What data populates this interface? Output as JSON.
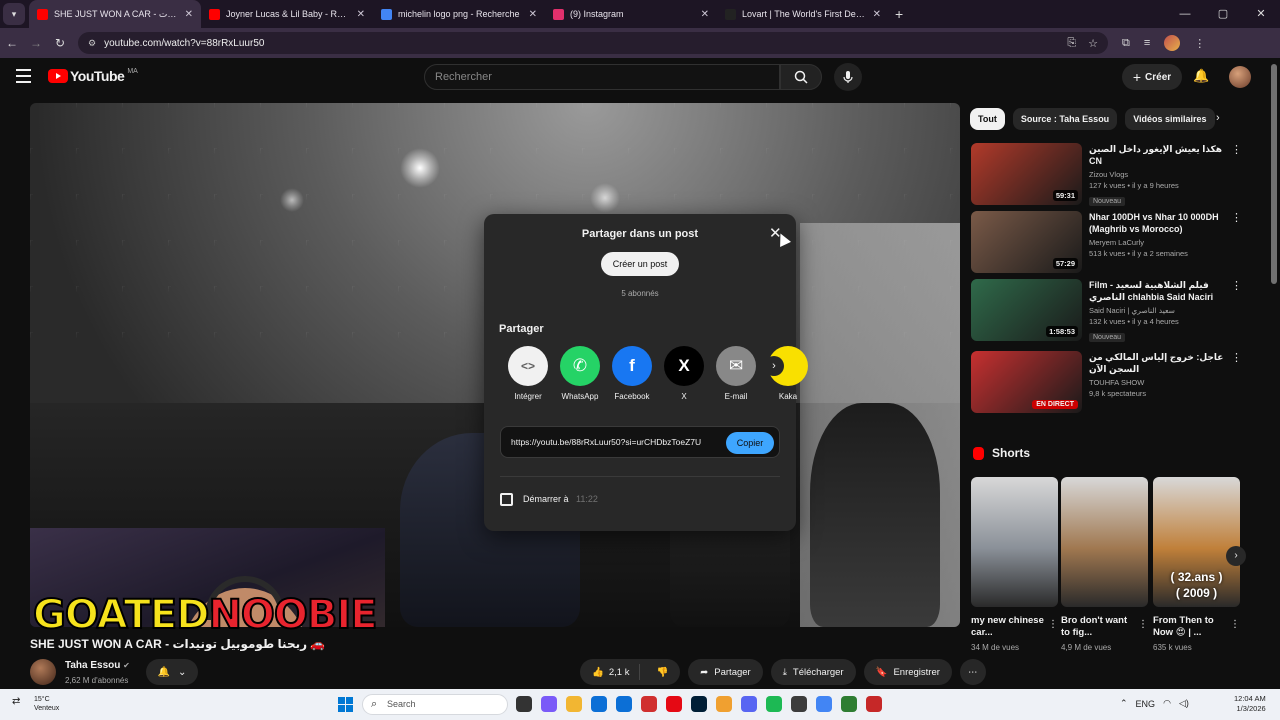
{
  "browser": {
    "tabs": [
      {
        "title": "SHE JUST WON A CAR - ربحنا طوموبيل تونيدات",
        "favicon_color": "#ff0000",
        "active": true
      },
      {
        "title": "Joyner Lucas & Lil Baby - Ramen",
        "favicon_color": "#ff0000",
        "active": false
      },
      {
        "title": "michelin logo png - Recherche",
        "favicon_color": "#4285f4",
        "active": false
      },
      {
        "title": "(9) Instagram",
        "favicon_color": "#e1306c",
        "active": false
      },
      {
        "title": "Lovart | The World's First Design",
        "favicon_color": "#222222",
        "active": false
      }
    ],
    "url": "youtube.com/watch?v=88rRxLuur50"
  },
  "youtube": {
    "logo_text": "YouTube",
    "country": "MA",
    "search_placeholder": "Rechercher",
    "create_label": "Créer"
  },
  "share_dialog": {
    "title": "Partager dans un post",
    "create_post": "Créer un post",
    "subscribers": "5 abonnés",
    "share_heading": "Partager",
    "targets": [
      {
        "label": "Intégrer",
        "glyph": "<>",
        "bg": "#f1f1f1",
        "fg": "#606060"
      },
      {
        "label": "WhatsApp",
        "glyph": "✆",
        "bg": "#25d366",
        "fg": "#ffffff"
      },
      {
        "label": "Facebook",
        "glyph": "f",
        "bg": "#1877f2",
        "fg": "#ffffff"
      },
      {
        "label": "X",
        "glyph": "X",
        "bg": "#000000",
        "fg": "#ffffff"
      },
      {
        "label": "E-mail",
        "glyph": "✉",
        "bg": "#888888",
        "fg": "#ffffff"
      },
      {
        "label": "Kaka",
        "glyph": "",
        "bg": "#f9e000",
        "fg": "#000000"
      }
    ],
    "link": "https://youtu.be/88rRxLuur50?si=urCHDbzToeZ7U",
    "copy_label": "Copier",
    "start_at_label": "Démarrer à",
    "start_time": "11:22"
  },
  "video": {
    "overlay_left": "GOATED",
    "overlay_right": "NOOBIE",
    "title": "SHE JUST WON A CAR - ربحنا طوموبيل تونيدات 🚗",
    "channel": "Taha Essou",
    "channel_subs": "2,62 M d'abonnés",
    "likes": "2,1 k",
    "share_label": "Partager",
    "download_label": "Télécharger",
    "save_label": "Enregistrer"
  },
  "sidebar": {
    "chips": [
      "Tout",
      "Source : Taha Essou",
      "Vidéos similaires"
    ],
    "recommendations": [
      {
        "title": "هكذا يعيش الإيغور داخل الصين CN",
        "channel": "Zizou Vlogs",
        "meta": "127 k vues • il y a 9 heures",
        "badge": "Nouveau",
        "duration": "59:31",
        "thumb": "#b23a2a"
      },
      {
        "title": "Nhar 100DH vs Nhar 10 000DH (Maghrib vs Morocco)",
        "channel": "Meryem LaCurly",
        "meta": "513 k vues • il y a 2 semaines",
        "badge": "",
        "duration": "57:29",
        "thumb": "#7a5a48"
      },
      {
        "title": "Film - فيلم الشلاهبية لسعيد الناصري chlahbia Said Naciri",
        "channel": "Said Naciri | سعيد الناصري",
        "meta": "132 k vues • il y a 4 heures",
        "badge": "Nouveau",
        "duration": "1:58:53",
        "thumb": "#2f6a4a"
      },
      {
        "title": "عاجل: خروج إلياس المالكي من السجن الآن",
        "channel": "TOUHFA SHOW",
        "meta": "9,8 k spectateurs",
        "badge": "",
        "duration": "EN DIRECT",
        "thumb": "#c73030"
      }
    ],
    "shorts_title": "Shorts",
    "shorts": [
      {
        "title": "my new chinese car...",
        "views": "34 M de vues",
        "thumb": "#8a9098"
      },
      {
        "title": "Bro don't want to fig...",
        "views": "4,9 M de vues",
        "thumb": "#a07850"
      },
      {
        "title": "From Then to Now 😍 | ...",
        "views": "635 k vues",
        "thumb": "#c0803a",
        "overlay": "( 32.ans )\n( 2009 )"
      }
    ]
  },
  "taskbar": {
    "temperature": "15°C",
    "weather": "Venteux",
    "search": "Search",
    "lang": "ENG",
    "time": "12:04 AM",
    "date": "1/3/2026",
    "app_colors": [
      "#333333",
      "#7a5af8",
      "#f2b632",
      "#0c6fd6",
      "#0c6fd6",
      "#d02f2f",
      "#e50914",
      "#001e36",
      "#f0a030",
      "#5865f2",
      "#1db954",
      "#3c3c3c",
      "#4285f4",
      "#2e7d32",
      "#c62828"
    ]
  }
}
